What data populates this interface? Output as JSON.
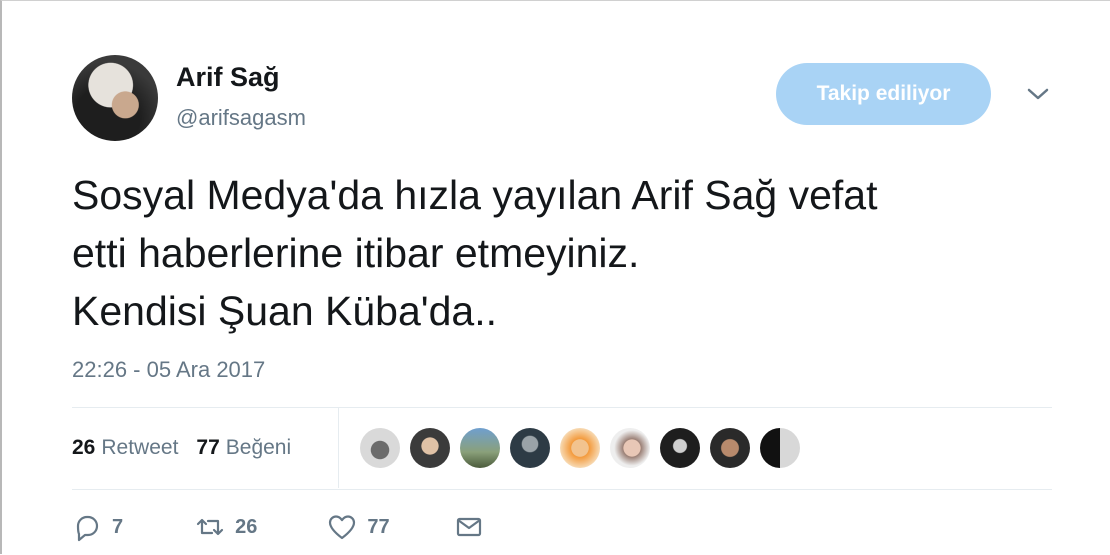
{
  "user": {
    "name": "Arif Sağ",
    "handle": "@arifsagasm"
  },
  "follow_button": {
    "label": "Takip ediliyor"
  },
  "tweet": {
    "lines": [
      "Sosyal Medya'da hızla yayılan Arif Sağ vefat",
      "etti haberlerine itibar etmeyiniz.",
      "Kendisi Şuan Küba'da.."
    ],
    "timestamp": "22:26 - 05 Ara 2017"
  },
  "stats": {
    "retweets_count": "26",
    "retweets_label": "Retweet",
    "likes_count": "77",
    "likes_label": "Beğeni"
  },
  "actions": {
    "reply_count": "7",
    "retweet_count": "26",
    "like_count": "77"
  },
  "icons": [
    "chevron-down-icon",
    "reply-icon",
    "retweet-icon",
    "heart-icon",
    "mail-icon"
  ],
  "colors": {
    "follow_button_bg": "#a9d3f5",
    "secondary_text": "#657786"
  }
}
